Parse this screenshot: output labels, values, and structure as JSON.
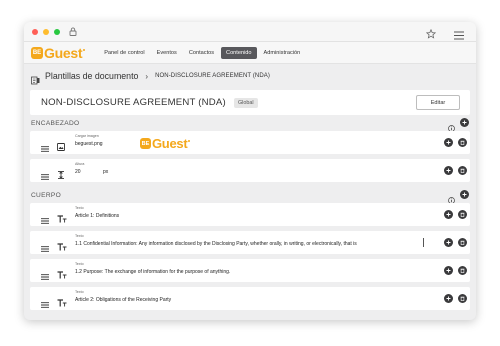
{
  "colors": {
    "brand": "#f4a81c",
    "nav_active": "#58585c",
    "button_dark": "#3a3a3c"
  },
  "nav": {
    "logo_badge": "BE",
    "logo_text": "Guest",
    "items": [
      {
        "label": "Panel de control"
      },
      {
        "label": "Eventos"
      },
      {
        "label": "Contactos"
      },
      {
        "label": "Contenido",
        "active": true
      },
      {
        "label": "Administración"
      }
    ]
  },
  "breadcrumb": {
    "section": "Plantillas de documento",
    "current": "NON-DISCLOSURE AGREEMENT (NDA)"
  },
  "document": {
    "title": "NON-DISCLOSURE AGREEMENT (NDA)",
    "badge": "Global",
    "edit_label": "Editar"
  },
  "sections": {
    "header": {
      "label": "ENCABEZADO",
      "rows": [
        {
          "label": "Cargar imagen",
          "value": "beguest.png",
          "icon": "image-icon"
        },
        {
          "label": "Altura",
          "value": "20",
          "unit": "px",
          "icon": "height-icon"
        }
      ]
    },
    "body": {
      "label": "CUERPO",
      "rows": [
        {
          "label": "Texto",
          "value": "Article 1: Definitions",
          "icon": "text-icon"
        },
        {
          "label": "Texto",
          "value": "1.1 Confidential Information: Any information disclosed by the Disclosing Party, whether orally, in writing, or electronically, that is",
          "icon": "text-icon"
        },
        {
          "label": "Texto",
          "value": "1.2 Purpose: The exchange of information for the purpose of anything.",
          "icon": "text-icon"
        },
        {
          "label": "Texto",
          "value": "Article 2: Obligations of the Receiving Party",
          "icon": "text-icon"
        }
      ]
    }
  }
}
